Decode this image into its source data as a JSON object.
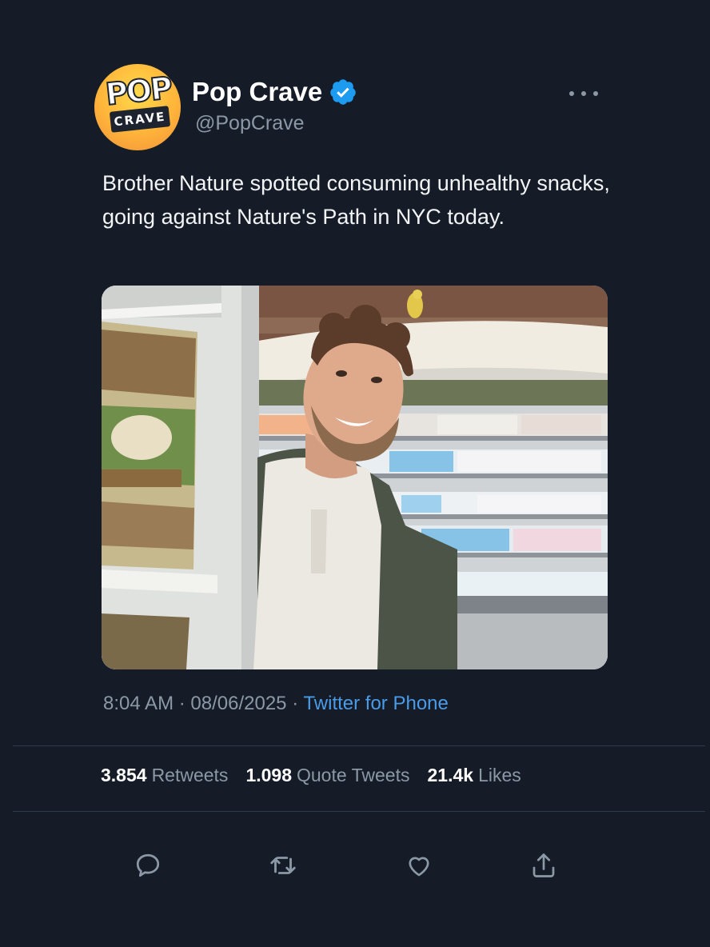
{
  "account": {
    "display_name": "Pop Crave",
    "handle": "@PopCrave",
    "avatar_logo_top": "POP",
    "avatar_logo_bottom": "CRAVE",
    "verified": true
  },
  "tweet": {
    "text": "Brother Nature spotted consuming unhealthy snacks, going against Nature's Path in NYC today.",
    "image_icon": "photo"
  },
  "meta": {
    "time": "8:04 AM",
    "separator": "·",
    "date": "08/06/2025",
    "source": "Twitter for Phone"
  },
  "stats": {
    "retweets_count": "3.854",
    "retweets_label": "Retweets",
    "quote_count": "1.098",
    "quote_label": "Quote Tweets",
    "likes_count": "21.4k",
    "likes_label": "Likes"
  },
  "actions": [
    "reply-icon",
    "retweet-icon",
    "like-icon",
    "share-icon"
  ],
  "colors": {
    "background": "#151c28",
    "link": "#4a9be8",
    "muted": "#8b98a5",
    "verified": "#1d9bf0"
  }
}
